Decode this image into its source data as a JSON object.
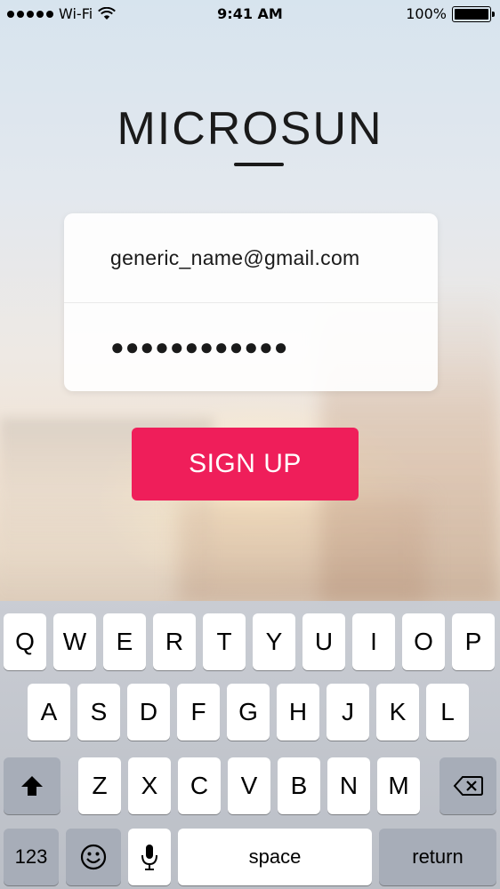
{
  "status_bar": {
    "carrier": "Wi-Fi",
    "time": "9:41 AM",
    "battery": "100%",
    "battery_level": 1.0
  },
  "logo": {
    "text": "MICROSUN"
  },
  "form": {
    "email_value": "generic_name@gmail.com",
    "password_value": "●●●●●●●●●●●●"
  },
  "signup_button": "SIGN UP",
  "keyboard": {
    "row1": [
      "Q",
      "W",
      "E",
      "R",
      "T",
      "Y",
      "U",
      "I",
      "O",
      "P"
    ],
    "row2": [
      "A",
      "S",
      "D",
      "F",
      "G",
      "H",
      "J",
      "K",
      "L"
    ],
    "row3": [
      "Z",
      "X",
      "C",
      "V",
      "B",
      "N",
      "M"
    ],
    "numbers_key": "123",
    "space_key": "space",
    "return_key": "return",
    "icons": [
      "shift-icon",
      "backspace-icon",
      "emoji-icon",
      "microphone-icon"
    ]
  },
  "colors": {
    "accent": "#ef1e5a"
  }
}
